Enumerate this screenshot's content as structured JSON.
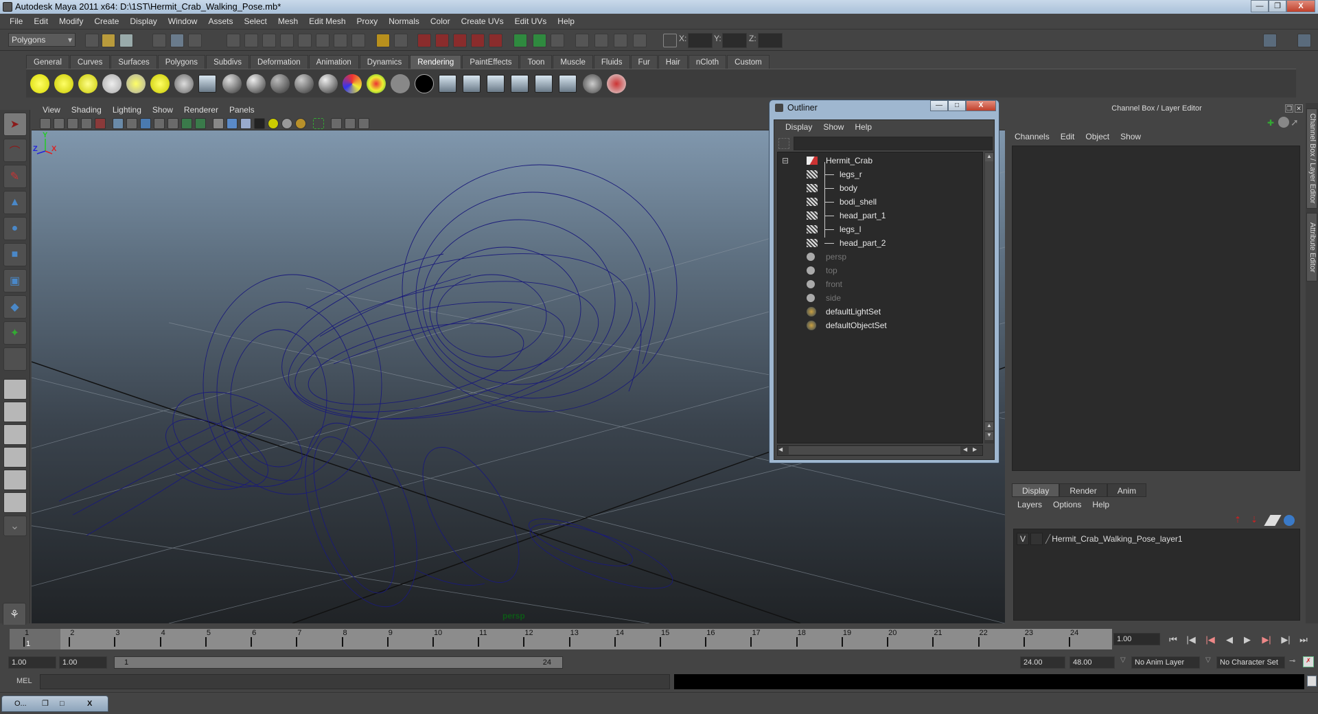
{
  "window": {
    "title": "Autodesk Maya 2011 x64: D:\\1ST\\Hermit_Crab_Walking_Pose.mb*",
    "controls": {
      "minimize": "—",
      "restore": "❐",
      "close": "X"
    }
  },
  "menubar": [
    "File",
    "Edit",
    "Modify",
    "Create",
    "Display",
    "Window",
    "Assets",
    "Select",
    "Mesh",
    "Edit Mesh",
    "Proxy",
    "Normals",
    "Color",
    "Create UVs",
    "Edit UVs",
    "Help"
  ],
  "statusline": {
    "menu_set": "Polygons",
    "xyz_labels": {
      "x": "X:",
      "y": "Y:",
      "z": "Z:"
    },
    "xyz_values": {
      "x": "",
      "y": "",
      "z": ""
    }
  },
  "shelf": {
    "tabs": [
      "General",
      "Curves",
      "Surfaces",
      "Polygons",
      "Subdivs",
      "Deformation",
      "Animation",
      "Dynamics",
      "Rendering",
      "PaintEffects",
      "Toon",
      "Muscle",
      "Fluids",
      "Fur",
      "Hair",
      "nCloth",
      "Custom"
    ],
    "active_tab": "Rendering",
    "icons": [
      "ambient-light",
      "directional-light",
      "point-light",
      "spot-light",
      "area-light",
      "volume-light",
      "camera",
      "hypershade",
      "blinn",
      "phong",
      "phongE",
      "lambert",
      "anisotropic",
      "ramp-shader",
      "layered-shader",
      "surface-shader",
      "use-background",
      "render-current",
      "ipr-render",
      "batch-render",
      "render-settings",
      "hypershade-window",
      "render-view",
      "light-linking",
      "paint-effects"
    ]
  },
  "panel": {
    "menu": [
      "View",
      "Shading",
      "Lighting",
      "Show",
      "Renderer",
      "Panels"
    ],
    "camera_label": "persp",
    "axis": {
      "x": "X",
      "y": "Y",
      "z": "Z"
    }
  },
  "outliner": {
    "title": "Outliner",
    "menu": [
      "Display",
      "Show",
      "Help"
    ],
    "filter_value": "",
    "items": [
      {
        "label": "Hermit_Crab",
        "type": "transform",
        "depth": 0,
        "dim": false
      },
      {
        "label": "legs_r",
        "type": "mesh",
        "depth": 1,
        "dim": false
      },
      {
        "label": "body",
        "type": "mesh",
        "depth": 1,
        "dim": false
      },
      {
        "label": "bodi_shell",
        "type": "mesh",
        "depth": 1,
        "dim": false
      },
      {
        "label": "head_part_1",
        "type": "mesh",
        "depth": 1,
        "dim": false
      },
      {
        "label": "legs_l",
        "type": "mesh",
        "depth": 1,
        "dim": false
      },
      {
        "label": "head_part_2",
        "type": "mesh",
        "depth": 1,
        "dim": false
      },
      {
        "label": "persp",
        "type": "camera",
        "depth": 0,
        "dim": true
      },
      {
        "label": "top",
        "type": "camera",
        "depth": 0,
        "dim": true
      },
      {
        "label": "front",
        "type": "camera",
        "depth": 0,
        "dim": true
      },
      {
        "label": "side",
        "type": "camera",
        "depth": 0,
        "dim": true
      },
      {
        "label": "defaultLightSet",
        "type": "set",
        "depth": 0,
        "dim": false
      },
      {
        "label": "defaultObjectSet",
        "type": "set",
        "depth": 0,
        "dim": false
      }
    ]
  },
  "channel_box": {
    "title": "Channel Box / Layer Editor",
    "menu": [
      "Channels",
      "Edit",
      "Object",
      "Show"
    ],
    "layer_tabs": [
      "Display",
      "Render",
      "Anim"
    ],
    "active_layer_tab": "Display",
    "layer_menu": [
      "Layers",
      "Options",
      "Help"
    ],
    "layers": [
      {
        "visible": "V",
        "name": "Hermit_Crab_Walking_Pose_layer1"
      }
    ]
  },
  "side_tabs": [
    "Channel Box / Layer Editor",
    "Attribute Editor"
  ],
  "time_slider": {
    "ticks": [
      "1",
      "2",
      "3",
      "4",
      "5",
      "6",
      "7",
      "8",
      "9",
      "10",
      "11",
      "12",
      "13",
      "14",
      "15",
      "16",
      "17",
      "18",
      "19",
      "20",
      "21",
      "22",
      "23",
      "24"
    ],
    "current_frame_marker": "1",
    "current_time": "1.00",
    "playback": [
      "go-to-start",
      "step-back-key",
      "step-back-frame",
      "play-backwards",
      "play-forwards",
      "step-forward-frame",
      "step-forward-key",
      "go-to-end"
    ]
  },
  "range_slider": {
    "start_time": "1.00",
    "playback_start": "1.00",
    "range_start_label": "1",
    "range_end_label": "24",
    "playback_end": "24.00",
    "end_time": "48.00",
    "anim_layer": "No Anim Layer",
    "character_set": "No Character Set"
  },
  "command_line": {
    "label": "MEL",
    "input": "",
    "output": ""
  },
  "help_line": {
    "minimized_window_label": "O..."
  }
}
